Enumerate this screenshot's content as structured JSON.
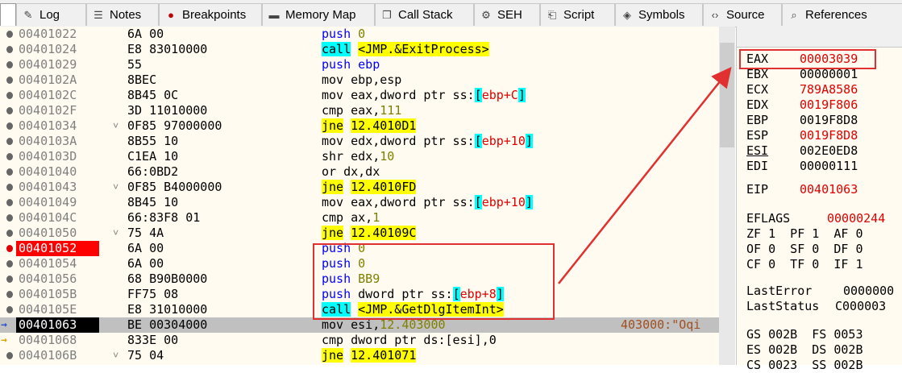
{
  "tabs": [
    {
      "label": "Log",
      "icon": "log-icon",
      "glyph": "✎"
    },
    {
      "label": "Notes",
      "icon": "notes-icon",
      "glyph": "☰"
    },
    {
      "label": "Breakpoints",
      "icon": "breakpoint-dot-icon",
      "glyph": "●"
    },
    {
      "label": "Memory Map",
      "icon": "memory-map-icon",
      "glyph": "▬"
    },
    {
      "label": "Call Stack",
      "icon": "call-stack-icon",
      "glyph": "❐"
    },
    {
      "label": "SEH",
      "icon": "seh-icon",
      "glyph": "⚙"
    },
    {
      "label": "Script",
      "icon": "script-icon",
      "glyph": "⎗"
    },
    {
      "label": "Symbols",
      "icon": "symbols-icon",
      "glyph": "◈"
    },
    {
      "label": "Source",
      "icon": "source-code-icon",
      "glyph": "‹›"
    },
    {
      "label": "References",
      "icon": "references-search-icon",
      "glyph": "⌕"
    }
  ],
  "disasm": [
    {
      "addr": "00401022",
      "bytes": "6A 00",
      "ins": [
        [
          "push ",
          "k-push"
        ],
        [
          "0",
          "k-num"
        ]
      ],
      "state": "normal"
    },
    {
      "addr": "00401024",
      "bytes": "E8 83010000",
      "ins": [
        [
          "call",
          "k-call"
        ],
        [
          " ",
          ""
        ],
        [
          "<JMP.&ExitProcess>",
          "k-hl"
        ]
      ],
      "state": "normal"
    },
    {
      "addr": "00401029",
      "bytes": "55",
      "ins": [
        [
          "push ",
          "k-push"
        ],
        [
          "ebp",
          "k-push"
        ]
      ],
      "state": "normal"
    },
    {
      "addr": "0040102A",
      "bytes": "8BEC",
      "ins": [
        [
          "mov ebp,esp",
          "k-plain"
        ]
      ],
      "state": "normal"
    },
    {
      "addr": "0040102C",
      "bytes": "8B45 0C",
      "ins": [
        [
          "mov eax,dword ptr ss:",
          "k-plain"
        ],
        [
          "[",
          "k-cyan"
        ],
        [
          "ebp+C",
          "k-red"
        ],
        [
          "]",
          "k-cyan"
        ]
      ],
      "state": "normal"
    },
    {
      "addr": "0040102F",
      "bytes": "3D 11010000",
      "ins": [
        [
          "cmp eax,",
          "k-plain"
        ],
        [
          "111",
          "k-num"
        ]
      ],
      "state": "normal"
    },
    {
      "addr": "00401034",
      "bytes": "0F85 97000000",
      "ins": [
        [
          "jne",
          "k-hl"
        ],
        [
          " ",
          ""
        ],
        [
          "12.4010D1",
          "k-hl"
        ]
      ],
      "state": "normal",
      "jmp": true
    },
    {
      "addr": "0040103A",
      "bytes": "8B55 10",
      "ins": [
        [
          "mov edx,dword ptr ss:",
          "k-plain"
        ],
        [
          "[",
          "k-cyan"
        ],
        [
          "ebp+10",
          "k-red"
        ],
        [
          "]",
          "k-cyan"
        ]
      ],
      "state": "normal"
    },
    {
      "addr": "0040103D",
      "bytes": "C1EA 10",
      "ins": [
        [
          "shr edx,",
          "k-plain"
        ],
        [
          "10",
          "k-num"
        ]
      ],
      "state": "normal"
    },
    {
      "addr": "00401040",
      "bytes": "66:0BD2",
      "ins": [
        [
          "or dx,dx",
          "k-plain"
        ]
      ],
      "state": "normal"
    },
    {
      "addr": "00401043",
      "bytes": "0F85 B4000000",
      "ins": [
        [
          "jne",
          "k-hl"
        ],
        [
          " ",
          ""
        ],
        [
          "12.4010FD",
          "k-hl"
        ]
      ],
      "state": "normal",
      "jmp": true
    },
    {
      "addr": "00401049",
      "bytes": "8B45 10",
      "ins": [
        [
          "mov eax,dword ptr ss:",
          "k-plain"
        ],
        [
          "[",
          "k-cyan"
        ],
        [
          "ebp+10",
          "k-red"
        ],
        [
          "]",
          "k-cyan"
        ]
      ],
      "state": "normal"
    },
    {
      "addr": "0040104C",
      "bytes": "66:83F8 01",
      "ins": [
        [
          "cmp ax,",
          "k-plain"
        ],
        [
          "1",
          "k-num"
        ]
      ],
      "state": "normal"
    },
    {
      "addr": "00401050",
      "bytes": "75 4A",
      "ins": [
        [
          "jne",
          "k-hl"
        ],
        [
          " ",
          ""
        ],
        [
          "12.40109C",
          "k-hl"
        ]
      ],
      "state": "normal",
      "jmp": true
    },
    {
      "addr": "00401052",
      "bytes": "6A 00",
      "ins": [
        [
          "push ",
          "k-push"
        ],
        [
          "0",
          "k-num"
        ]
      ],
      "state": "breakpoint"
    },
    {
      "addr": "00401054",
      "bytes": "6A 00",
      "ins": [
        [
          "push ",
          "k-push"
        ],
        [
          "0",
          "k-num"
        ]
      ],
      "state": "normal"
    },
    {
      "addr": "00401056",
      "bytes": "68 B90B0000",
      "ins": [
        [
          "push ",
          "k-push"
        ],
        [
          "BB9",
          "k-num"
        ]
      ],
      "state": "normal"
    },
    {
      "addr": "0040105B",
      "bytes": "FF75 08",
      "ins": [
        [
          "push ",
          "k-push"
        ],
        [
          "dword ptr ss:",
          "k-plain"
        ],
        [
          "[",
          "k-cyan"
        ],
        [
          "ebp+8",
          "k-red"
        ],
        [
          "]",
          "k-cyan"
        ]
      ],
      "state": "normal"
    },
    {
      "addr": "0040105E",
      "bytes": "E8 31010000",
      "ins": [
        [
          "call",
          "k-call"
        ],
        [
          " ",
          ""
        ],
        [
          "<JMP.&GetDlgItemInt>",
          "k-hl"
        ]
      ],
      "state": "normal"
    },
    {
      "addr": "00401063",
      "bytes": "BE 00304000",
      "ins": [
        [
          "mov esi,",
          "k-plain"
        ],
        [
          "12.403000",
          "k-num"
        ]
      ],
      "state": "current",
      "comment": "403000:\"Oqi"
    },
    {
      "addr": "00401068",
      "bytes": "833E 00",
      "ins": [
        [
          "cmp dword ptr ds:",
          "k-plain"
        ],
        [
          "[esi]",
          "k-plain"
        ],
        [
          ",0",
          "k-plain"
        ]
      ],
      "state": "normal",
      "ymark": true
    },
    {
      "addr": "0040106B",
      "bytes": "75 04",
      "ins": [
        [
          "jne",
          "k-hl"
        ],
        [
          " ",
          ""
        ],
        [
          "12.401071",
          "k-hl"
        ]
      ],
      "state": "normal",
      "jmp": true
    }
  ],
  "registers": [
    {
      "name": "EAX",
      "value": "00003039",
      "changed": true
    },
    {
      "name": "EBX",
      "value": "00000001",
      "changed": false
    },
    {
      "name": "ECX",
      "value": "789A8586",
      "changed": true
    },
    {
      "name": "EDX",
      "value": "0019F806",
      "changed": true
    },
    {
      "name": "EBP",
      "value": "0019F8D8",
      "changed": false
    },
    {
      "name": "ESP",
      "value": "0019F8D8",
      "changed": true
    },
    {
      "name": "ESI",
      "value": "002E0ED8",
      "changed": false,
      "underline": true
    },
    {
      "name": "EDI",
      "value": "00000111",
      "changed": false
    }
  ],
  "eip": {
    "name": "EIP",
    "value": "00401063"
  },
  "eflags": {
    "name": "EFLAGS",
    "value": "00000244"
  },
  "flags_rows": [
    "ZF 1  PF 1  AF 0",
    "OF 0  SF 0  DF 0",
    "CF 0  TF 0  IF 1"
  ],
  "last_error": {
    "name": "LastError",
    "value": "0000000"
  },
  "last_status": {
    "name": "LastStatus",
    "value": "C000003"
  },
  "segments": [
    "GS 002B  FS 0053",
    "ES 002B  DS 002B",
    "CS 0023  SS 002B"
  ],
  "colors": {
    "annotation": "#e03030",
    "breakpoint": "#ff0000",
    "highlight": "#ffff00",
    "changed_register": "#e00000"
  }
}
